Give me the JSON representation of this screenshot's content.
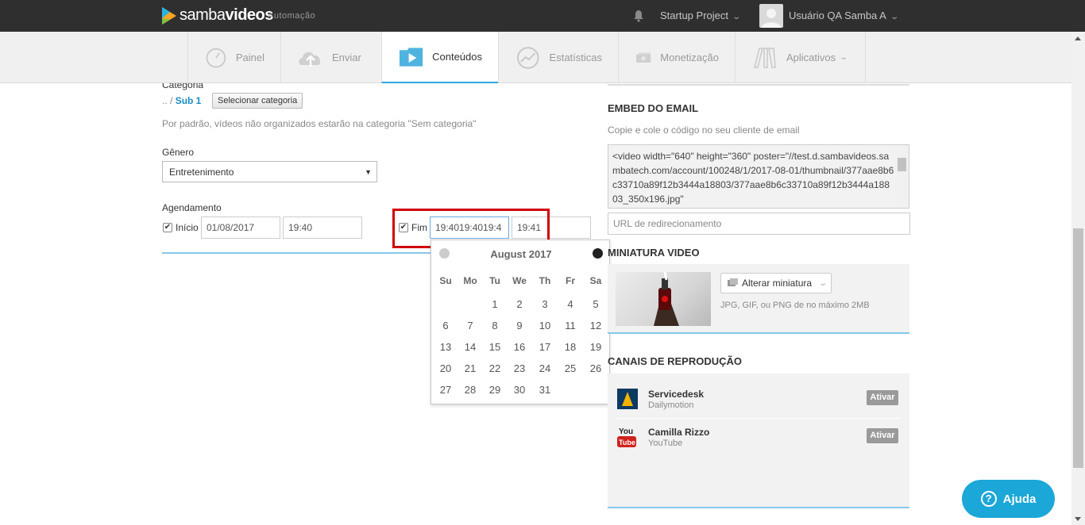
{
  "header": {
    "logo_text_left": "samba",
    "logo_text_right": "videos",
    "logo_sub": "Automação",
    "project": "Startup Project",
    "user": "Usuário QA Samba A"
  },
  "nav": {
    "items": [
      {
        "label": "Painel",
        "icon": "dashboard-icon"
      },
      {
        "label": "Enviar",
        "icon": "cloud-upload-icon"
      },
      {
        "label": "Conteúdos",
        "icon": "folder-play-icon"
      },
      {
        "label": "Estatísticas",
        "icon": "chart-circle-icon"
      },
      {
        "label": "Monetização",
        "icon": "money-icon"
      },
      {
        "label": "Aplicativos",
        "icon": "apps-icon"
      }
    ],
    "active": "Conteúdos"
  },
  "left": {
    "category_label": "Categoria",
    "breadcrumb_prefix": ".. /",
    "breadcrumb_current": "Sub 1",
    "select_category_button": "Selecionar categoria",
    "category_hint": "Por padrão, vídeos não organizados estarão na categoria \"Sem categoria\"",
    "genre_label": "Gênero",
    "genre_value": "Entretenimento",
    "schedule_label": "Agendamento",
    "start_label": "Início",
    "start_date": "01/08/2017",
    "start_time": "19:40",
    "end_label": "Fim",
    "end_date": "19:4019:4019:4",
    "end_time": "19:41"
  },
  "datepicker": {
    "month_title": "August 2017",
    "weekdays": [
      "Su",
      "Mo",
      "Tu",
      "We",
      "Th",
      "Fr",
      "Sa"
    ],
    "days": [
      "1",
      "2",
      "3",
      "4",
      "5",
      "6",
      "7",
      "8",
      "9",
      "10",
      "11",
      "12",
      "13",
      "14",
      "15",
      "16",
      "17",
      "18",
      "19",
      "20",
      "21",
      "22",
      "23",
      "24",
      "25",
      "26",
      "27",
      "28",
      "29",
      "30",
      "31"
    ]
  },
  "right": {
    "embed_title": "EMBED DO EMAIL",
    "embed_hint": "Copie e cole o código no seu cliente de email",
    "embed_code": "<video width=\"640\" height=\"360\" poster=\"//test.d.sambavideos.sambatech.com/account/100248/1/2017-08-01/thumbnail/377aae8b6c33710a89f12b3444a18803/377aae8b6c33710a89f12b3444a18803_350x196.jpg\"",
    "redirect_placeholder": "URL de redirecionamento",
    "thumbnail_title": "MINIATURA VIDEO",
    "thumbnail_button": "Alterar miniatura",
    "thumbnail_hint": "JPG, GIF, ou PNG de no máximo 2MB",
    "channels_title": "CANAIS DE REPRODUÇÃO",
    "channels": [
      {
        "name": "Servicedesk",
        "provider": "Dailymotion",
        "action": "Ativar"
      },
      {
        "name": "Camilla Rizzo",
        "provider": "YouTube",
        "action": "Ativar"
      }
    ]
  },
  "help_button": "Ajuda",
  "colors": {
    "accent": "#29a9e0",
    "topbar": "#2f2f2f",
    "highlight": "#d10000",
    "help": "#1ba7d8"
  }
}
